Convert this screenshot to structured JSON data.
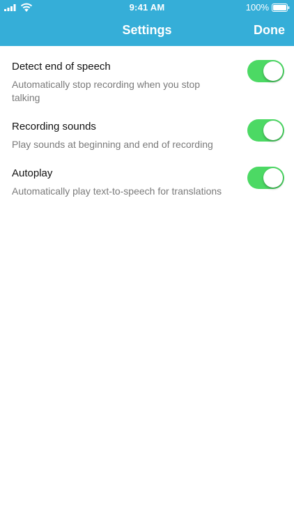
{
  "status_bar": {
    "time": "9:41 AM",
    "battery_percent": "100%",
    "signal_icon": "signal-bars-icon",
    "wifi_icon": "wifi-icon",
    "battery_icon": "battery-icon"
  },
  "nav": {
    "title": "Settings",
    "done_label": "Done"
  },
  "colors": {
    "nav_background": "#35aed8",
    "toggle_on": "#4cd964",
    "description_text": "#7a7a7a"
  },
  "settings": [
    {
      "title": "Detect end of speech",
      "description": "Automatically stop recording when you stop talking",
      "enabled": true
    },
    {
      "title": "Recording sounds",
      "description": "Play sounds at beginning and end of recording",
      "enabled": true
    },
    {
      "title": "Autoplay",
      "description": "Automatically play text-to-speech for translations",
      "enabled": true
    }
  ]
}
